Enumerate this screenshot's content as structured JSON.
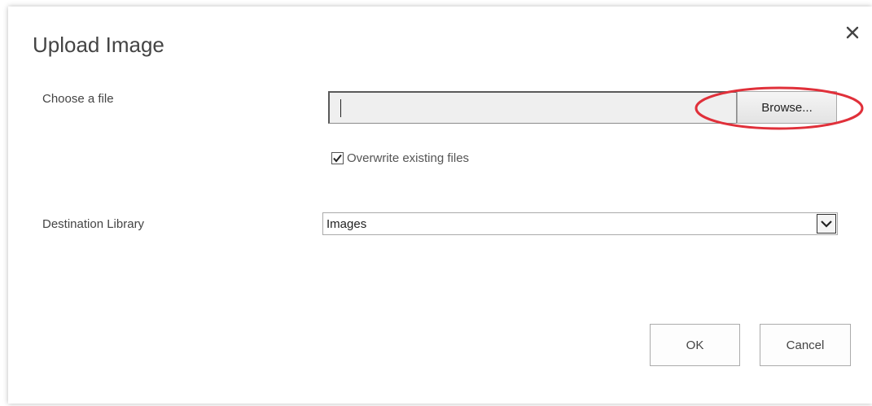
{
  "dialog": {
    "title": "Upload Image",
    "close_icon": "close-icon"
  },
  "file": {
    "label": "Choose a file",
    "value": "",
    "browse_label": "Browse...",
    "highlight_color": "#e0303a"
  },
  "overwrite": {
    "label": "Overwrite existing files",
    "checked": true
  },
  "destination": {
    "label": "Destination Library",
    "selected": "Images",
    "arrow_icon": "chevron-down-icon"
  },
  "buttons": {
    "ok_label": "OK",
    "cancel_label": "Cancel"
  }
}
